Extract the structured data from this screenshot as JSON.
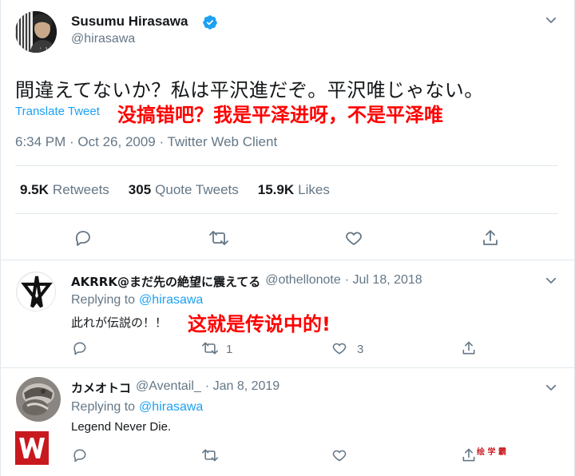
{
  "main_tweet": {
    "display_name": "Susumu Hirasawa",
    "handle": "@hirasawa",
    "text": "間違えてないか？私は平沢進だぞ。平沢唯じゃない。",
    "translate_label": "Translate Tweet",
    "overlay_translation": "没搞错吧？我是平泽进呀，不是平泽唯",
    "meta": "6:34 PM · Oct 26, 2009 · Twitter Web Client",
    "stats": {
      "retweets_count": "9.5K",
      "retweets_label": "Retweets",
      "quotes_count": "305",
      "quotes_label": "Quote Tweets",
      "likes_count": "15.9K",
      "likes_label": "Likes"
    }
  },
  "replies": [
    {
      "display_name": "AKRRK@まだ先の絶望に震えてる",
      "handle": "@othellonote",
      "date": "· Jul 18, 2018",
      "replying_prefix": "Replying to",
      "replying_handle": "@hirasawa",
      "text": "此れが伝説の！！",
      "overlay_translation": "这就是传说中的!",
      "retweet_count": "1",
      "like_count": "3"
    },
    {
      "display_name": "カメオトコ",
      "handle": "@Aventail_",
      "date": "· Jan 8, 2019",
      "replying_prefix": "Replying to",
      "replying_handle": "@hirasawa",
      "text": "Legend Never Die.",
      "watermark_text": "绘 学 霸"
    }
  ],
  "colors": {
    "accent": "#1da1f2",
    "muted": "#657786",
    "overlay_red": "#ff0000",
    "divider": "#e1e8ed"
  }
}
